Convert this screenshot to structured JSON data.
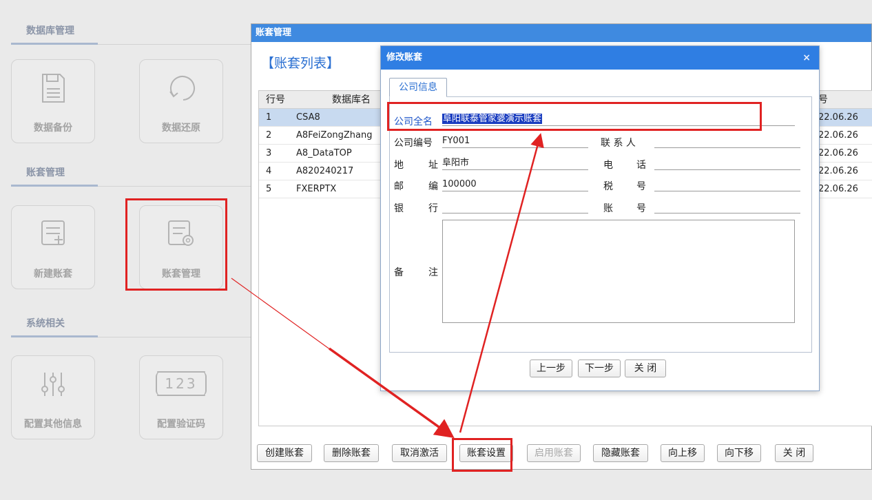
{
  "sidebar": {
    "sections": [
      {
        "title": "数据库管理",
        "tiles": [
          "数据备份",
          "数据还原"
        ]
      },
      {
        "title": "账套管理",
        "tiles": [
          "新建账套",
          "账套管理"
        ]
      },
      {
        "title": "系统相关",
        "tiles": [
          "配置其他信息",
          "配置验证码"
        ]
      }
    ],
    "verify_code_glyph": "123"
  },
  "main_window": {
    "title": "账套管理",
    "list_heading": "【账套列表】",
    "columns": [
      "行号",
      "数据库名",
      "号"
    ],
    "rows": [
      {
        "no": "1",
        "db": "CSA8",
        "date": "22.06.26"
      },
      {
        "no": "2",
        "db": "A8FeiZongZhang",
        "date": "22.06.26"
      },
      {
        "no": "3",
        "db": "A8_DataTOP",
        "date": "22.06.26"
      },
      {
        "no": "4",
        "db": "A820240217",
        "date": "22.06.26"
      },
      {
        "no": "5",
        "db": "FXERPTX",
        "date": "22.06.26"
      }
    ],
    "buttons": [
      "创建账套",
      "删除账套",
      "取消激活",
      "账套设置",
      "启用账套",
      "隐藏账套",
      "向上移",
      "向下移",
      "关 闭"
    ]
  },
  "dialog": {
    "title": "修改账套",
    "close_glyph": "×",
    "tab": "公司信息",
    "fields": {
      "company_name_label": "公司全名",
      "company_name_value": "阜阳联泰管家婆演示账套",
      "company_code_label": "公司编号",
      "company_code_value": "FY001",
      "contact_label": "联 系 人",
      "contact_value": "",
      "address_label_a": "地",
      "address_label_b": "址",
      "address_value": "阜阳市",
      "phone_label_a": "电",
      "phone_label_b": "话",
      "phone_value": "",
      "postcode_label_a": "邮",
      "postcode_label_b": "编",
      "postcode_value": "100000",
      "tax_label_a": "税",
      "tax_label_b": "号",
      "tax_value": "",
      "bank_label_a": "银",
      "bank_label_b": "行",
      "bank_value": "",
      "account_label_a": "账",
      "account_label_b": "号",
      "account_value": "",
      "memo_label_a": "备",
      "memo_label_b": "注",
      "memo_value": ""
    },
    "buttons": {
      "prev": "上一步",
      "next": "下一步",
      "close": "关 闭"
    }
  },
  "colors": {
    "title_bar": "#3f8ae0",
    "dialog_bar": "#2f7ee3",
    "annotation_red": "#e02222",
    "selection": "#c8daf0"
  }
}
